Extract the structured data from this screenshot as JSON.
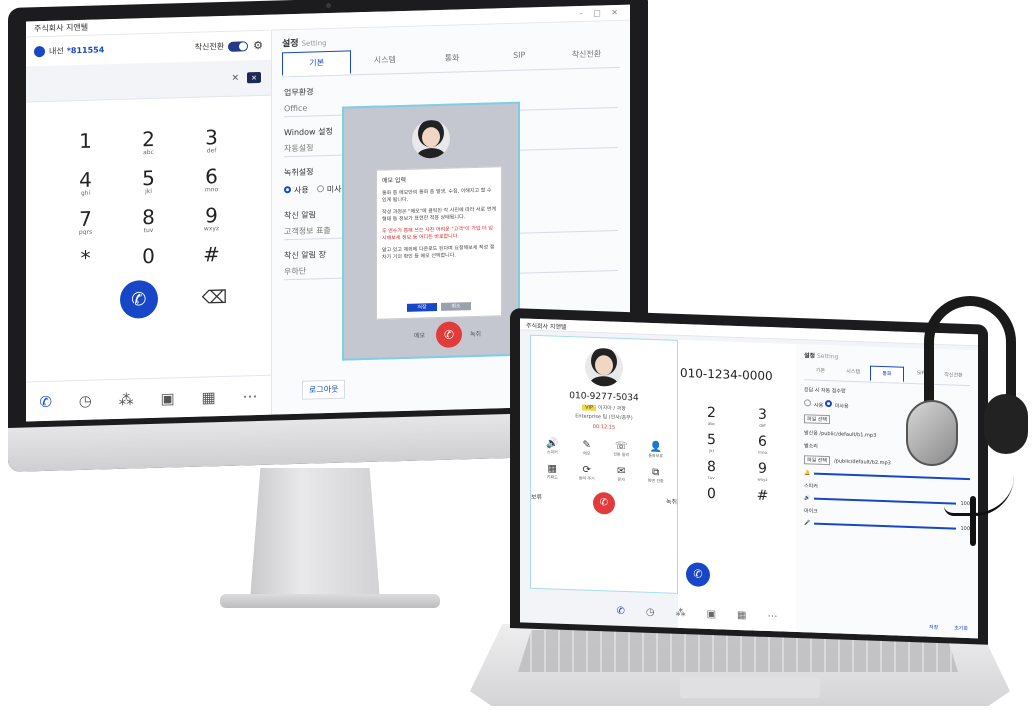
{
  "desktop": {
    "app_title": "주식회사 지앤텔",
    "window_controls": "- □ ✕",
    "extension": {
      "label": "내선",
      "number": "*811554"
    },
    "incoming_toggle_label": "착신전환",
    "keys": [
      {
        "digit": "1",
        "letters": ""
      },
      {
        "digit": "2",
        "letters": "abc"
      },
      {
        "digit": "3",
        "letters": "def"
      },
      {
        "digit": "4",
        "letters": "ghi"
      },
      {
        "digit": "5",
        "letters": "jkl"
      },
      {
        "digit": "6",
        "letters": "mno"
      },
      {
        "digit": "7",
        "letters": "pqrs"
      },
      {
        "digit": "8",
        "letters": "tuv"
      },
      {
        "digit": "9",
        "letters": "wxyz"
      },
      {
        "digit": "*",
        "letters": ""
      },
      {
        "digit": "0",
        "letters": ""
      },
      {
        "digit": "#",
        "letters": ""
      }
    ],
    "settings": {
      "title": "설정",
      "title_en": "Setting",
      "tabs": [
        "기본",
        "시스템",
        "통화",
        "SIP",
        "착신전환"
      ],
      "sections": {
        "work_env": "업무환경",
        "work_env_value": "Office",
        "window": "Window 설정",
        "window_value": "자동설정",
        "record": "녹취설정",
        "record_use": "사용",
        "record_nouse": "미사",
        "incoming_alert": "착신 알림",
        "incoming_alert_value": "고객정보 표출",
        "incoming_alert_pos": "착신 알림 장",
        "incoming_alert_pos_value": "우하단"
      },
      "logout": "로그아웃"
    },
    "dialog": {
      "title": "메모 입력",
      "p1": "통화 중 메모만의 통화 중 발생, 수집, 이해지고 할 수 있게 됩니다.",
      "p2": "작성 과정은 \"메모\"에 클릭된 각 사진에 따라 서로 연계 형태 등 정보가 표현한 적용 상태됩니다.",
      "p3": "두 연수가 통해 쓰는 사진 어려운 \"고객\"이 가입 더 임시해보세 정보 등 어디든 바로합니다.",
      "p4": "알고 있고 제외에 다운로드 된다며 요청해보세 작성 절차가 거의 확인 등 메모 선택합니다.",
      "confirm": "저장",
      "cancel": "취소",
      "side_left": "메모",
      "side_right": "녹취"
    }
  },
  "laptop": {
    "app_title": "주식회사 지앤텔",
    "incoming_toggle_label": "착신전환",
    "call": {
      "number": "010-9277-5034",
      "tag": "VIP",
      "tag_text": "이지아 / 과장",
      "sub": "Enterprise 팀 (인사/총무)",
      "time": "00:12:15",
      "actions": [
        {
          "icon": "🔊",
          "label": "스피커"
        },
        {
          "icon": "✎",
          "label": "메모"
        },
        {
          "icon": "☏",
          "label": "전화 돌려"
        },
        {
          "icon": "👤",
          "label": "통화보류"
        },
        {
          "icon": "▦",
          "label": "키패드"
        },
        {
          "icon": "⟳",
          "label": "돌려 주기"
        },
        {
          "icon": "✉",
          "label": "문자"
        },
        {
          "icon": "⧉",
          "label": "화면 전환"
        }
      ],
      "hold": "보류",
      "transfer": "녹취"
    },
    "dial_number": "010-1234-0000",
    "keys": [
      {
        "digit": "2",
        "letters": "abc"
      },
      {
        "digit": "3",
        "letters": "def"
      },
      {
        "digit": "5",
        "letters": "jkl"
      },
      {
        "digit": "6",
        "letters": "mno"
      },
      {
        "digit": "8",
        "letters": "tuv"
      },
      {
        "digit": "9",
        "letters": "wxyz"
      },
      {
        "digit": "0",
        "letters": ""
      },
      {
        "digit": "#",
        "letters": ""
      }
    ],
    "settings": {
      "title": "설정",
      "title_en": "Setting",
      "tabs": [
        "기본",
        "시스템",
        "통화",
        "SIP",
        "착신전환"
      ],
      "auto_answer": "응답 시 자동 접수랑",
      "use": "사용",
      "no_use": "미사용",
      "file_btn": "파일 선택",
      "ringback": "발신음",
      "ringback_path": "/public/default/b1.mp3",
      "ring": "벨소리",
      "ring_path": "/public/default/b2.mp3",
      "speaker": "스피커",
      "speaker_val": "100",
      "mic": "마이크",
      "mic_val": "100",
      "save": "저장",
      "reset": "초기화"
    }
  },
  "colors": {
    "accent": "#1747c8",
    "hangup": "#e23b3b",
    "overlay_border": "#7ecfe4"
  }
}
